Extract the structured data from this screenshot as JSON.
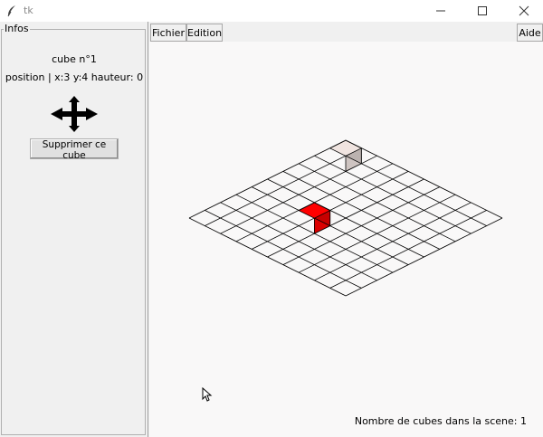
{
  "window": {
    "title": "tk"
  },
  "infos": {
    "group_label": "Infos",
    "cube_name": "cube n°1",
    "cube_position": "position | x:3 y:4 hauteur: 0",
    "move_icon": "four-way-arrow-icon",
    "delete_button_label": "Supprimer ce cube"
  },
  "menu": {
    "fichier": "Fichier",
    "edition": "Edition",
    "aide": "Aide"
  },
  "scene": {
    "grid_size": 10,
    "status": "Nombre de cubes dans la scene: 1",
    "cubes": [
      {
        "x": 3,
        "y": 4,
        "height": 0,
        "color": "#ff0000",
        "selected": true
      },
      {
        "x": 8,
        "y": 1,
        "height": 0,
        "color": "#f0e4e0",
        "selected": false
      }
    ],
    "grid_color": "#000000"
  }
}
